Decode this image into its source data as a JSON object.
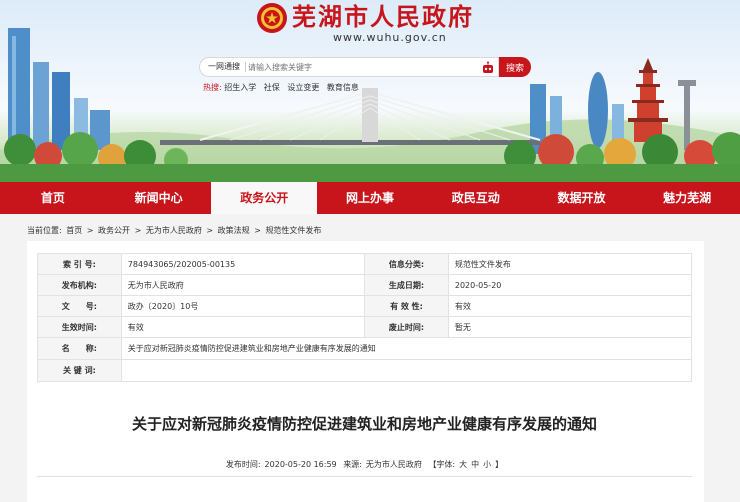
{
  "header": {
    "site_title": "芜湖市人民政府",
    "site_url": "www.wuhu.gov.cn"
  },
  "search": {
    "scope": "一网通搜",
    "placeholder": "请输入搜索关键字",
    "button": "搜索"
  },
  "hot": {
    "label": "热搜:",
    "items": [
      "招生入学",
      "社保",
      "设立变更",
      "教育信息"
    ]
  },
  "nav": {
    "items": [
      "首页",
      "新闻中心",
      "政务公开",
      "网上办事",
      "政民互动",
      "数据开放",
      "魅力芜湖"
    ],
    "active_index": 2
  },
  "breadcrumb": {
    "prefix": "当前位置:",
    "items": [
      "首页",
      "政务公开",
      "无为市人民政府",
      "政策法规",
      "规范性文件发布"
    ],
    "separator": ">"
  },
  "meta": {
    "index_label": "索 引 号:",
    "index_value": "784943065/202005-00135",
    "category_label": "信息分类:",
    "category_value": "规范性文件发布",
    "publisher_label": "发布机构:",
    "publisher_value": "无为市人民政府",
    "created_label": "生成日期:",
    "created_value": "2020-05-20",
    "docno_label": "文　　号:",
    "docno_value": "政办〔2020〕10号",
    "validity_label": "有 效 性:",
    "validity_value": "有效",
    "effective_label": "生效时间:",
    "effective_value": "有效",
    "expire_label": "废止时间:",
    "expire_value": "暂无",
    "name_label": "名　　称:",
    "name_value": "关于应对新冠肺炎疫情防控促进建筑业和房地产业健康有序发展的通知",
    "keywords_label": "关 键 词:",
    "keywords_value": ""
  },
  "article": {
    "title": "关于应对新冠肺炎疫情防控促进建筑业和房地产业健康有序发展的通知",
    "published_label": "发布时间:",
    "published_value": "2020-05-20 16:59",
    "source_label": "来源:",
    "source_value": "无为市人民政府",
    "font_label": "【字体:",
    "font_large": "大",
    "font_medium": "中",
    "font_small": "小",
    "font_close": "】"
  },
  "colors": {
    "brand_red": "#c8141b"
  }
}
